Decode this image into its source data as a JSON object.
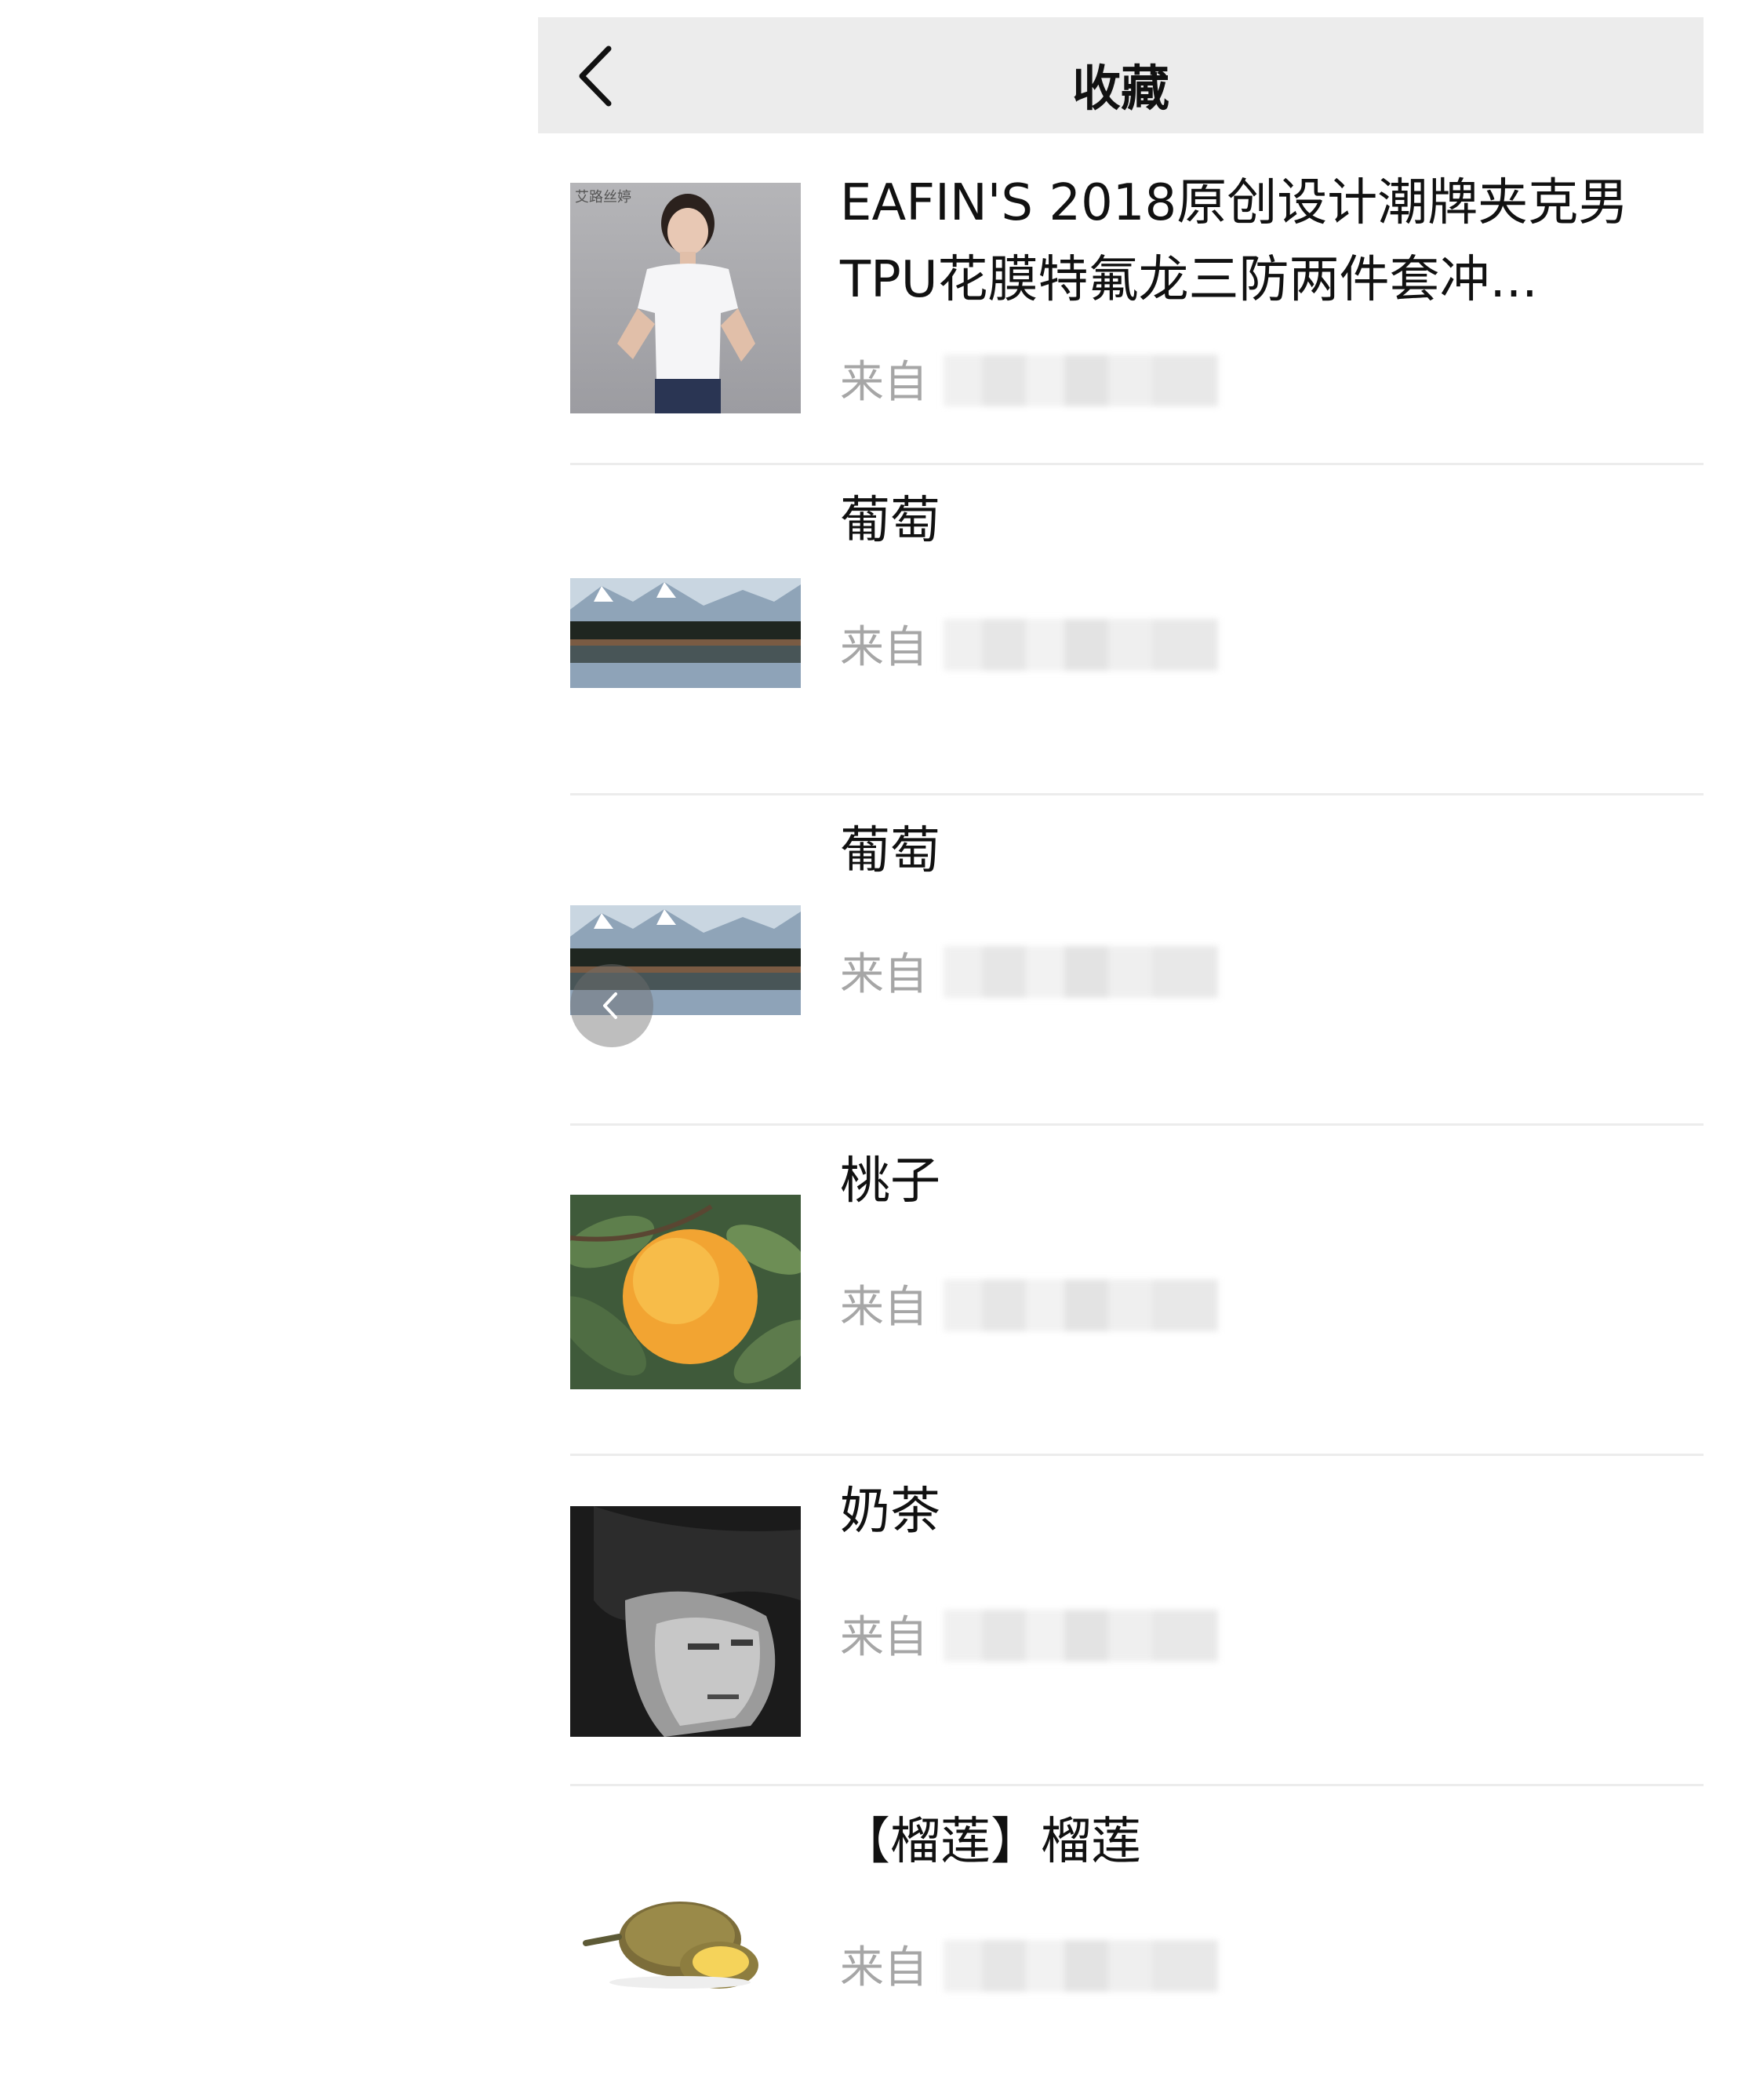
{
  "nav": {
    "title": "收藏"
  },
  "items": [
    {
      "title": "EAFIN'S 2018原创设计潮牌夹克男TPU花膜特氟龙三防两件套冲...",
      "source_label": "来自",
      "thumb": "woman-white-tshirt",
      "thumb_caption": "艾路丝婷"
    },
    {
      "title": "葡萄",
      "source_label": "来自",
      "thumb": "mountain-lake"
    },
    {
      "title": "葡萄",
      "source_label": "来自",
      "thumb": "mountain-lake"
    },
    {
      "title": "桃子",
      "source_label": "来自",
      "thumb": "peach"
    },
    {
      "title": "奶茶",
      "source_label": "来自",
      "thumb": "bw-portrait"
    },
    {
      "title": "【榴莲】榴莲",
      "source_label": "来自",
      "thumb": "durian"
    }
  ],
  "colors": {
    "nav_bg": "#ececec",
    "divider": "#ececec",
    "source_gray": "#a6a6a6"
  }
}
